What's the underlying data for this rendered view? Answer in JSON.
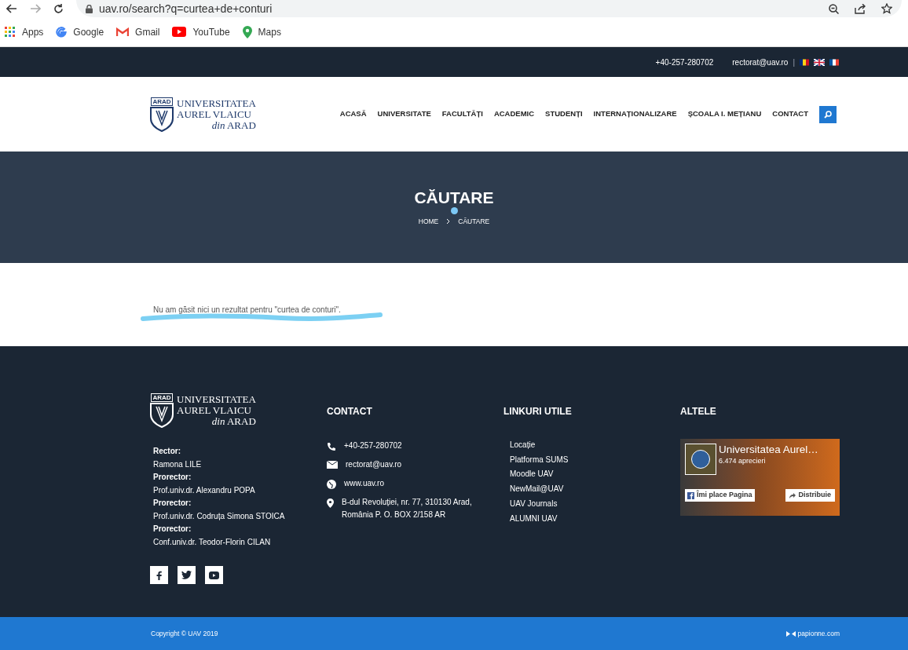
{
  "browser": {
    "url": "uav.ro/search?q=curtea+de+conturi",
    "bookmarks": [
      {
        "kind": "apps",
        "label": "Apps"
      },
      {
        "kind": "google",
        "label": "Google"
      },
      {
        "kind": "gmail",
        "label": "Gmail"
      },
      {
        "kind": "youtube",
        "label": "YouTube"
      },
      {
        "kind": "maps",
        "label": "Maps"
      }
    ]
  },
  "topbar": {
    "phone": "+40-257-280702",
    "email": "rectorat@uav.ro",
    "separator": "|",
    "languages": [
      {
        "kind": "ro"
      },
      {
        "kind": "en"
      },
      {
        "kind": "fr"
      }
    ]
  },
  "logo": {
    "badge": "ARAD",
    "line1": "UNIVERSITATEA",
    "line2": "AUREL VLAICU",
    "line3_italic": "din",
    "line3": "ARAD"
  },
  "footer_logo": {
    "badge": "ARAD",
    "line1": "UNIVERSITATEA",
    "line2": "AUREL VLAICU",
    "line3_italic": "din",
    "line3": "ARAD"
  },
  "nav": [
    "ACASĂ",
    "UNIVERSITATE",
    "FACULTĂȚI",
    "ACADEMIC",
    "STUDENȚI",
    "INTERNAȚIONALIZARE",
    "ȘCOALA I. MEȚIANU",
    "CONTACT"
  ],
  "hero": {
    "title": "CĂUTARE",
    "breadcrumb": [
      "HOME",
      "CĂUTARE"
    ]
  },
  "message": "Nu am găsit nici un rezultat pentru \"curtea de conturi\".",
  "footer": {
    "leaders": [
      {
        "role": "Rector:",
        "name": "Ramona LILE"
      },
      {
        "role": "Prorector:",
        "name": "Prof.univ.dr. Alexandru POPA"
      },
      {
        "role": "Prorector:",
        "name": "Prof.univ.dr. Codruța Simona STOICA"
      },
      {
        "role": "Prorector:",
        "name": "Conf.univ.dr. Teodor-Florin CILAN"
      }
    ],
    "social": [
      {
        "kind": "facebook"
      },
      {
        "kind": "twitter"
      },
      {
        "kind": "youtube"
      }
    ],
    "contact": {
      "title": "CONTACT",
      "items": [
        {
          "kind": "phone",
          "text": "+40-257-280702"
        },
        {
          "kind": "email",
          "text": "rectorat@uav.ro"
        },
        {
          "kind": "web",
          "text": "www.uav.ro"
        },
        {
          "kind": "address",
          "text": "B-dul Revoluției, nr. 77, 310130 Arad, România P. O. BOX 2/158 AR"
        }
      ]
    },
    "links": {
      "title": "LINKURI UTILE",
      "items": [
        "Locație",
        "Platforma SUMS",
        "Moodle UAV",
        "NewMail@UAV",
        "UAV Journals",
        "ALUMNI UAV"
      ]
    },
    "other": {
      "title": "ALTELE",
      "page_name": "Universitatea Aurel…",
      "likes": "6.474 aprecieri",
      "like_button": "Îmi place Pagina",
      "share_button": "Distribuie"
    }
  },
  "bottom": {
    "copyright": "Copyright © UAV 2019",
    "credit": "papionne.com"
  }
}
